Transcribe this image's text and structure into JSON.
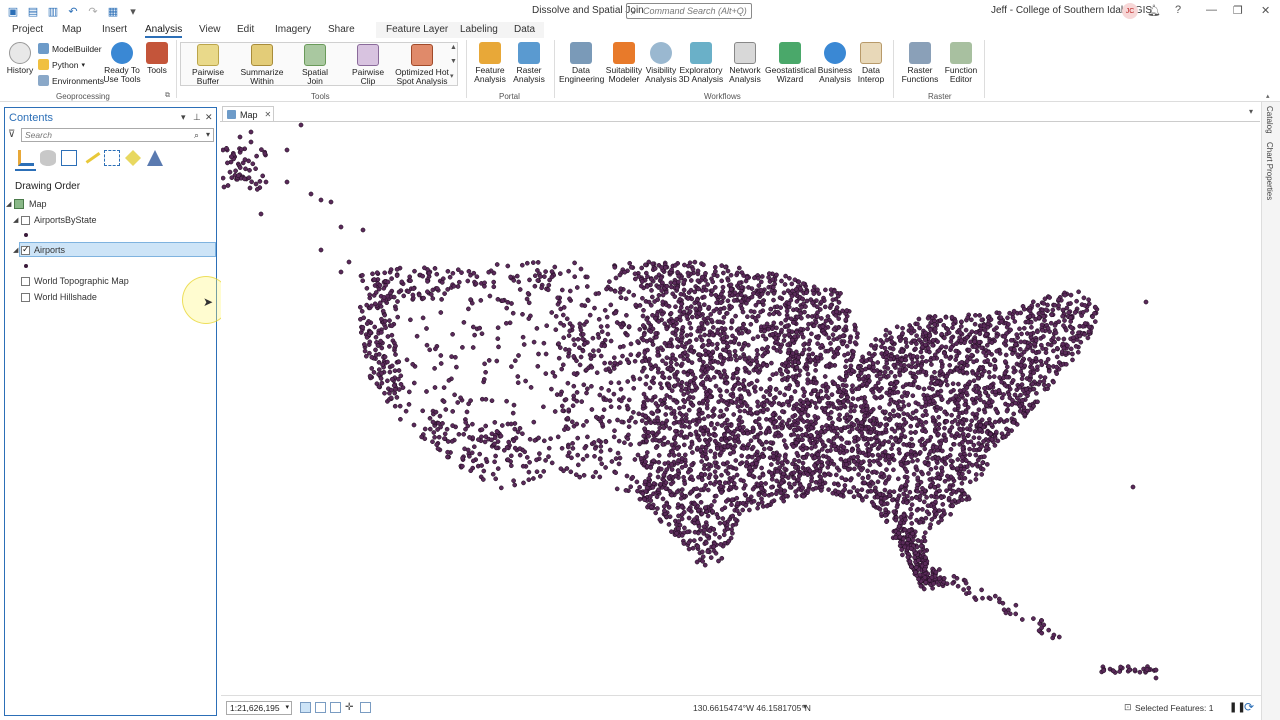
{
  "titlebar": {
    "document_title": "Dissolve and Spatial Join",
    "command_search_placeholder": "Command Search (Alt+Q)",
    "user": "Jeff - College of Southern Idaho GIS",
    "avatar_initials": "JC",
    "icons": [
      "new-project-icon",
      "open-icon",
      "save-icon",
      "undo-icon",
      "redo-icon",
      "customize-icon",
      "notifications-icon",
      "help-icon",
      "minimize-icon",
      "restore-icon",
      "close-icon"
    ]
  },
  "tabs": [
    "Project",
    "Map",
    "Insert",
    "Analysis",
    "View",
    "Edit",
    "Imagery",
    "Share",
    "Feature Layer",
    "Labeling",
    "Data"
  ],
  "active_tab": "Analysis",
  "ribbon": {
    "geoprocessing": {
      "label": "Geoprocessing",
      "history": "History",
      "modelbuilder": "ModelBuilder",
      "python": "Python",
      "environments": "Environments",
      "ready_to_use_1": "Ready To",
      "ready_to_use_2": "Use Tools",
      "tools": "Tools"
    },
    "tools": {
      "label": "Tools",
      "items": [
        {
          "l1": "Pairwise",
          "l2": "Buffer"
        },
        {
          "l1": "Summarize",
          "l2": "Within"
        },
        {
          "l1": "Spatial",
          "l2": "Join"
        },
        {
          "l1": "Pairwise",
          "l2": "Clip"
        },
        {
          "l1": "Optimized Hot",
          "l2": "Spot Analysis"
        }
      ]
    },
    "portal": {
      "label": "Portal",
      "items": [
        {
          "l1": "Feature",
          "l2": "Analysis"
        },
        {
          "l1": "Raster",
          "l2": "Analysis"
        }
      ]
    },
    "workflows": {
      "label": "Workflows",
      "items": [
        {
          "l1": "Data",
          "l2": "Engineering"
        },
        {
          "l1": "Suitability",
          "l2": "Modeler"
        },
        {
          "l1": "Visibility",
          "l2": "Analysis"
        },
        {
          "l1": "Exploratory",
          "l2": "3D Analysis"
        },
        {
          "l1": "Network",
          "l2": "Analysis"
        },
        {
          "l1": "Geostatistical",
          "l2": "Wizard"
        },
        {
          "l1": "Business",
          "l2": "Analysis"
        },
        {
          "l1": "Data",
          "l2": "Interop"
        }
      ]
    },
    "raster": {
      "label": "Raster",
      "items": [
        {
          "l1": "Raster",
          "l2": "Functions"
        },
        {
          "l1": "Function",
          "l2": "Editor"
        }
      ]
    }
  },
  "contents": {
    "title": "Contents",
    "search_placeholder": "Search",
    "drawing_order": "Drawing Order",
    "map": "Map",
    "layers": [
      "AirportsByState",
      "Airports",
      "World Topographic Map",
      "World Hillshade"
    ]
  },
  "map_view": {
    "tab_label": "Map",
    "point_color": "#5a2a5a",
    "point_stroke": "#1a0a1a"
  },
  "status": {
    "scale": "1:21,626,195",
    "coordinates": "130.6615474°W 46.1581705°N",
    "selected_features": "Selected Features: 1"
  },
  "right_dock": [
    "Catalog",
    "Chart Properties"
  ],
  "colors": {
    "accent": "#2c6fb7",
    "selection": "#cde4f7"
  }
}
